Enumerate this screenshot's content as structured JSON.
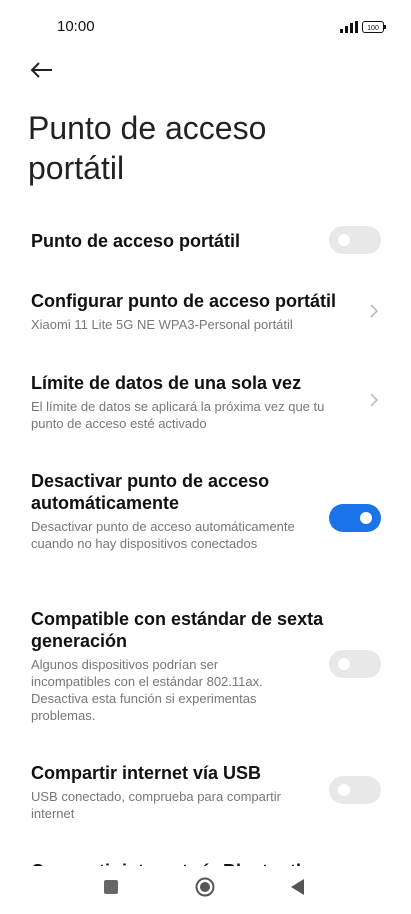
{
  "status": {
    "time": "10:00",
    "battery": "100"
  },
  "header": {
    "title": "Punto de acceso portátil"
  },
  "settings": [
    {
      "title": "Punto de acceso portátil",
      "subtitle": "",
      "control": "toggle",
      "on": false
    },
    {
      "title": "Configurar punto de acceso portátil",
      "subtitle": "Xiaomi 11 Lite 5G NE WPA3-Personal portátil",
      "control": "chevron"
    },
    {
      "title": "Límite de datos de una sola vez",
      "subtitle": "El límite de datos se aplicará la próxima vez que tu punto de acceso esté activado",
      "control": "chevron"
    },
    {
      "title": "Desactivar punto de acceso automáticamente",
      "subtitle": "Desactivar punto de acceso automáticamente cuando no hay dispositivos conectados",
      "control": "toggle",
      "on": true
    },
    {
      "title": "Compatible con estándar de sexta generación",
      "subtitle": "Algunos dispositivos podrían ser incompatibles con el estándar 802.11ax. Desactiva esta función si experimentas problemas.",
      "control": "toggle",
      "on": false
    },
    {
      "title": "Compartir internet vía USB",
      "subtitle": "USB conectado, comprueba para compartir internet",
      "control": "toggle",
      "on": false
    }
  ],
  "partial_row": "Compartir internet vía Bluetooth",
  "colors": {
    "accent": "#1a73e8",
    "toggle_off": "#e8e8e8",
    "subtitle": "#777777"
  },
  "icons": [
    "back-arrow-icon",
    "chevron-right-icon",
    "signal-icon",
    "battery-icon",
    "recents-square-icon",
    "home-circle-icon",
    "back-triangle-icon"
  ]
}
